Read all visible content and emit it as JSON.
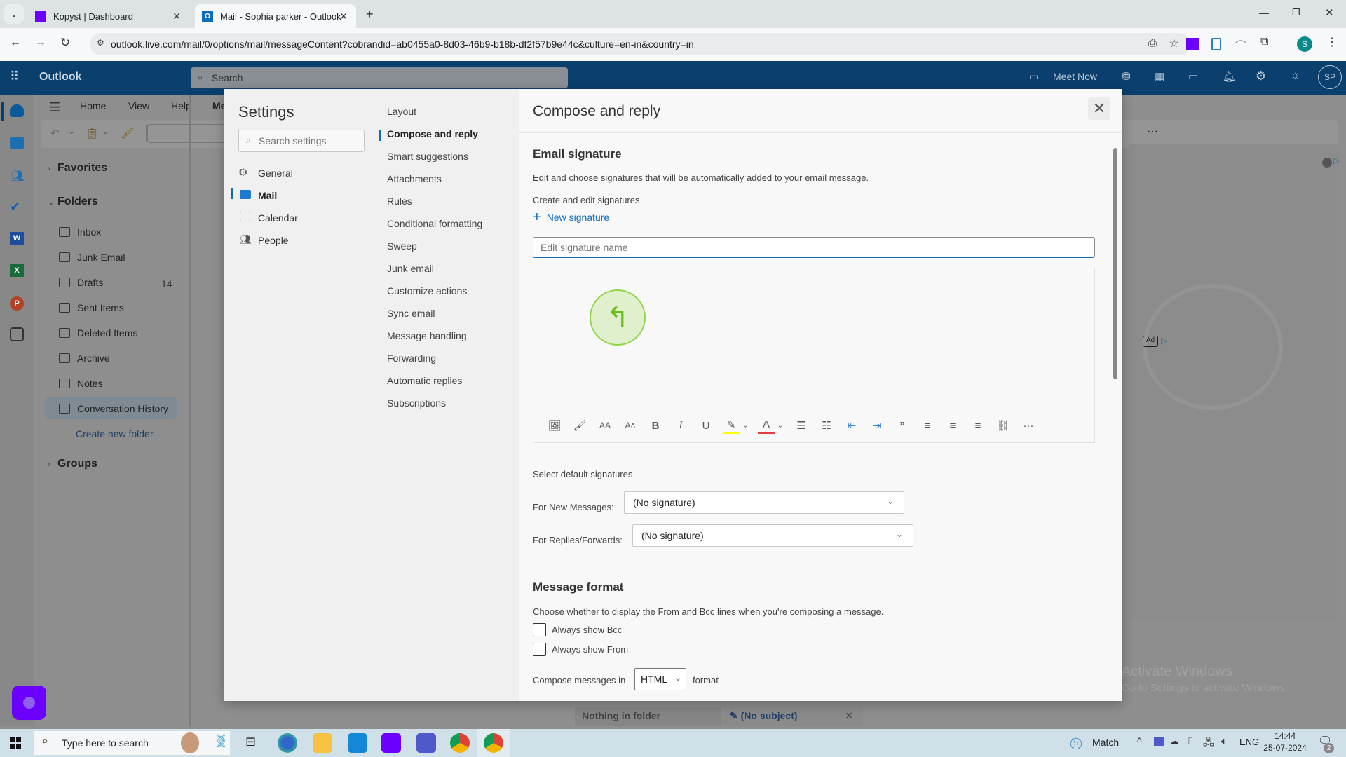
{
  "browser": {
    "tabs": [
      {
        "title": "Kopyst | Dashboard",
        "icon": "kopyst-icon",
        "active": false
      },
      {
        "title": "Mail - Sophia parker - Outlook",
        "icon": "outlook-icon",
        "active": true
      }
    ],
    "new_tab": "+",
    "url": "outlook.live.com/mail/0/options/mail/messageContent?cobrandid=ab0455a0-8d03-46b9-b18b-df2f57b9e44c&culture=en-in&country=in",
    "profile_initial": "S",
    "window_controls": [
      "minimize",
      "restore",
      "close"
    ]
  },
  "outlook": {
    "app_name": "Outlook",
    "search_placeholder": "Search",
    "meet_now": "Meet Now",
    "avatar_initials": "SP",
    "ribbon_tabs": [
      "Home",
      "View",
      "Help",
      "Me"
    ],
    "favorites_label": "Favorites",
    "folders_label": "Folders",
    "folders": [
      {
        "name": "Inbox",
        "icon": "inbox-icon",
        "count": ""
      },
      {
        "name": "Junk Email",
        "icon": "junk-icon",
        "count": ""
      },
      {
        "name": "Drafts",
        "icon": "drafts-icon",
        "count": "14"
      },
      {
        "name": "Sent Items",
        "icon": "sent-icon",
        "count": ""
      },
      {
        "name": "Deleted Items",
        "icon": "trash-icon",
        "count": ""
      },
      {
        "name": "Archive",
        "icon": "archive-icon",
        "count": ""
      },
      {
        "name": "Notes",
        "icon": "notes-icon",
        "count": ""
      },
      {
        "name": "Conversation History",
        "icon": "folder-icon",
        "count": "",
        "selected": true
      }
    ],
    "create_folder": "Create new folder",
    "groups_label": "Groups",
    "empty_folder": "Nothing in folder",
    "draft_tab": "(No subject)",
    "ad_label": "Ad",
    "activate_title": "Activate Windows",
    "activate_sub": "Go to Settings to activate Windows."
  },
  "settings": {
    "title": "Settings",
    "search_placeholder": "Search settings",
    "categories": [
      {
        "label": "General",
        "icon": "gear-icon"
      },
      {
        "label": "Mail",
        "icon": "mail-icon",
        "active": true
      },
      {
        "label": "Calendar",
        "icon": "calendar-icon"
      },
      {
        "label": "People",
        "icon": "people-icon"
      }
    ],
    "subcategories": [
      "Layout",
      "Compose and reply",
      "Smart suggestions",
      "Attachments",
      "Rules",
      "Conditional formatting",
      "Sweep",
      "Junk email",
      "Customize actions",
      "Sync email",
      "Message handling",
      "Forwarding",
      "Automatic replies",
      "Subscriptions"
    ],
    "active_sub": "Compose and reply",
    "panel": {
      "title": "Compose and reply",
      "signature_heading": "Email signature",
      "signature_desc": "Edit and choose signatures that will be automatically added to your email message.",
      "create_edit_label": "Create and edit signatures",
      "new_signature": "New signature",
      "sig_name_placeholder": "Edit signature name",
      "sig_name_value": "",
      "toolbar": [
        "insert-picture",
        "format-painter",
        "font",
        "font-size",
        "bold",
        "italic",
        "underline",
        "highlight",
        "font-color",
        "bullets",
        "numbering",
        "decrease-indent",
        "increase-indent",
        "quote",
        "align-left",
        "align-center",
        "align-right",
        "link",
        "more"
      ],
      "highlight_color": "#ffff00",
      "font_color": "#e04040",
      "default_sig_label": "Select default signatures",
      "new_messages_label": "For New Messages:",
      "new_messages_value": "(No signature)",
      "replies_label": "For Replies/Forwards:",
      "replies_value": "(No signature)",
      "format_heading": "Message format",
      "format_desc": "Choose whether to display the From and Bcc lines when you're composing a message.",
      "always_bcc": "Always show Bcc",
      "always_bcc_checked": false,
      "always_from": "Always show From",
      "always_from_checked": false,
      "compose_in_label": "Compose messages in",
      "compose_format": "HTML",
      "format_suffix": "format"
    }
  },
  "taskbar": {
    "search_placeholder": "Type here to search",
    "weather_label": "Match",
    "language": "ENG",
    "time": "14:44",
    "date": "25-07-2024",
    "notification_count": "2"
  },
  "colors": {
    "outlook_header": "#0a3f6e",
    "accent": "#0f6cbd",
    "kopyst_purple": "#6b00ff"
  }
}
